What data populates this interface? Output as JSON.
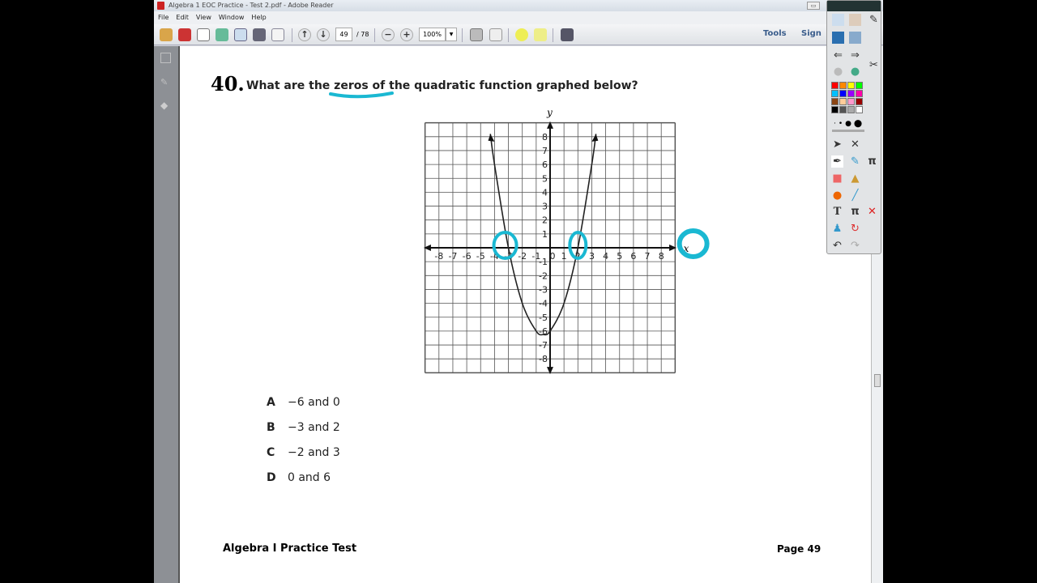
{
  "window": {
    "title": "Algebra 1 EOC Practice - Test 2.pdf - Adobe Reader"
  },
  "menu": [
    "File",
    "Edit",
    "View",
    "Window",
    "Help"
  ],
  "toolbar": {
    "page_current": "49",
    "page_total": "/ 78",
    "zoom": "100%",
    "tools_label": "Tools",
    "sign_label": "Sign"
  },
  "question": {
    "number": "40.",
    "text": "What are the zeros of the quadratic function graphed below?"
  },
  "choices": [
    {
      "letter": "A",
      "text": "−6 and 0"
    },
    {
      "letter": "B",
      "text": "−3 and 2"
    },
    {
      "letter": "C",
      "text": "−2 and 3"
    },
    {
      "letter": "D",
      "text": "0 and 6"
    }
  ],
  "footer": {
    "left": "Algebra I Practice Test",
    "right": "Page 49"
  },
  "annotation_color": "#1ab8d2",
  "palette_colors": [
    "#ff0000",
    "#ff8800",
    "#ffff00",
    "#00ff00",
    "#00c0ff",
    "#0000ff",
    "#9900ff",
    "#ff00aa",
    "#8b4513",
    "#ffcc99",
    "#ff99cc",
    "#990000",
    "#000000",
    "#555555",
    "#aaaaaa",
    "#ffffff"
  ],
  "chart_data": {
    "type": "line",
    "xlabel": "x",
    "ylabel": "y",
    "xlim": [
      -9,
      9
    ],
    "ylim": [
      -9,
      9
    ],
    "grid": true,
    "xticks": [
      "-8",
      "-7",
      "-6",
      "-5",
      "-4",
      "-3",
      "-2",
      "-1",
      "0",
      "1",
      "2",
      "3",
      "4",
      "5",
      "6",
      "7",
      "8"
    ],
    "yticks": [
      "8",
      "7",
      "6",
      "5",
      "4",
      "3",
      "2",
      "1",
      "-1",
      "-2",
      "-3",
      "-4",
      "-5",
      "-6",
      "-7",
      "-8"
    ],
    "series": [
      {
        "points": [
          [
            -4.3,
            8.2
          ],
          [
            -4,
            6
          ],
          [
            -3,
            0
          ],
          [
            -2,
            -4
          ],
          [
            -1,
            -6
          ],
          [
            -0.5,
            -6.25
          ],
          [
            0,
            -6
          ],
          [
            1,
            -4
          ],
          [
            2,
            0
          ],
          [
            3,
            6
          ],
          [
            3.3,
            8.2
          ]
        ]
      }
    ],
    "highlighted_zeros": [
      -3,
      2
    ]
  }
}
